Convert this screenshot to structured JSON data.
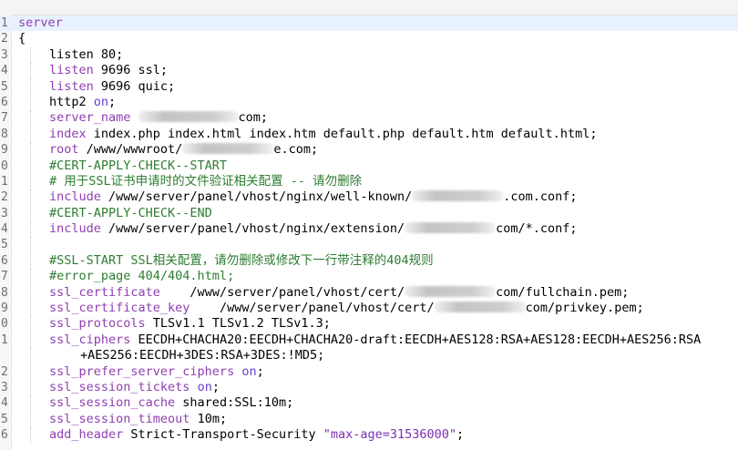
{
  "editor": {
    "lines": [
      {
        "num": "1",
        "current": true,
        "indent": 0,
        "segments": [
          {
            "t": "server",
            "c": "kw"
          }
        ]
      },
      {
        "num": "2",
        "indent": 0,
        "segments": [
          {
            "t": "{"
          }
        ]
      },
      {
        "num": "3",
        "indent": 1,
        "segments": [
          {
            "t": "listen 80;"
          }
        ]
      },
      {
        "num": "4",
        "indent": 1,
        "segments": [
          {
            "t": "listen",
            "c": "kw"
          },
          {
            "t": " 9696 ssl;"
          }
        ]
      },
      {
        "num": "5",
        "indent": 1,
        "segments": [
          {
            "t": "listen",
            "c": "kw"
          },
          {
            "t": " 9696 quic;"
          }
        ]
      },
      {
        "num": "6",
        "indent": 1,
        "segments": [
          {
            "t": "http2 "
          },
          {
            "t": "on",
            "c": "bool"
          },
          {
            "t": ";"
          }
        ]
      },
      {
        "num": "7",
        "indent": 1,
        "segments": [
          {
            "t": "server_name",
            "c": "kw"
          },
          {
            "t": " "
          },
          {
            "blur": 110
          },
          {
            "t": "com;"
          }
        ]
      },
      {
        "num": "8",
        "indent": 1,
        "segments": [
          {
            "t": "index",
            "c": "kw"
          },
          {
            "t": " index.php index.html index.htm default.php default.htm default.html;"
          }
        ]
      },
      {
        "num": "9",
        "indent": 1,
        "segments": [
          {
            "t": "root",
            "c": "kw"
          },
          {
            "t": " /www/wwwroot/"
          },
          {
            "blur": 100
          },
          {
            "t": "e.com;"
          }
        ]
      },
      {
        "num": "0",
        "indent": 1,
        "segments": [
          {
            "t": "#CERT-APPLY-CHECK--START",
            "c": "cmt"
          }
        ]
      },
      {
        "num": "1",
        "indent": 1,
        "segments": [
          {
            "t": "# 用于SSL证书申请时的文件验证相关配置 -- 请勿删除",
            "c": "cmt"
          }
        ]
      },
      {
        "num": "2",
        "indent": 1,
        "segments": [
          {
            "t": "include",
            "c": "kw"
          },
          {
            "t": " /www/server/panel/vhost/nginx/well-known/"
          },
          {
            "blur": 100
          },
          {
            "t": ".com.conf;"
          }
        ]
      },
      {
        "num": "3",
        "indent": 1,
        "segments": [
          {
            "t": "#CERT-APPLY-CHECK--END",
            "c": "cmt"
          }
        ]
      },
      {
        "num": "4",
        "indent": 1,
        "segments": [
          {
            "t": "include",
            "c": "kw"
          },
          {
            "t": " /www/server/panel/vhost/nginx/extension/"
          },
          {
            "blur": 100
          },
          {
            "t": "com/*.conf;"
          }
        ]
      },
      {
        "num": "5",
        "indent": 1,
        "segments": [
          {
            "t": ""
          }
        ]
      },
      {
        "num": "6",
        "indent": 1,
        "segments": [
          {
            "t": "#SSL-START SSL相关配置，请勿删除或修改下一行带注释的404规则",
            "c": "cmt"
          }
        ]
      },
      {
        "num": "7",
        "indent": 1,
        "segments": [
          {
            "t": "#error_page 404/404.html;",
            "c": "cmt"
          }
        ]
      },
      {
        "num": "8",
        "indent": 1,
        "segments": [
          {
            "t": "ssl_certificate",
            "c": "kw"
          },
          {
            "t": "    /www/server/panel/vhost/cert/"
          },
          {
            "blur": 100
          },
          {
            "t": "com/fullchain.pem;"
          }
        ]
      },
      {
        "num": "9",
        "indent": 1,
        "segments": [
          {
            "t": "ssl_certificate_key",
            "c": "kw"
          },
          {
            "t": "    /www/server/panel/vhost/cert/"
          },
          {
            "blur": 100
          },
          {
            "t": "com/privkey.pem;"
          }
        ]
      },
      {
        "num": "0",
        "indent": 1,
        "segments": [
          {
            "t": "ssl_protocols",
            "c": "kw"
          },
          {
            "t": " TLSv1.1 TLSv1.2 TLSv1.3;"
          }
        ]
      },
      {
        "num": "1",
        "indent": 1,
        "segments": [
          {
            "t": "ssl_ciphers",
            "c": "kw"
          },
          {
            "t": " EECDH+CHACHA20:EECDH+CHACHA20-draft:EECDH+AES128:RSA+AES128:EECDH+AES256:RSA"
          }
        ]
      },
      {
        "num": "",
        "indent": 2,
        "segments": [
          {
            "t": "+AES256:EECDH+3DES:RSA+3DES:!MD5;"
          }
        ]
      },
      {
        "num": "2",
        "indent": 1,
        "segments": [
          {
            "t": "ssl_prefer_server_ciphers",
            "c": "kw"
          },
          {
            "t": " "
          },
          {
            "t": "on",
            "c": "bool"
          },
          {
            "t": ";"
          }
        ]
      },
      {
        "num": "3",
        "indent": 1,
        "segments": [
          {
            "t": "ssl_session_tickets",
            "c": "kw"
          },
          {
            "t": " "
          },
          {
            "t": "on",
            "c": "bool"
          },
          {
            "t": ";"
          }
        ]
      },
      {
        "num": "4",
        "indent": 1,
        "segments": [
          {
            "t": "ssl_session_cache",
            "c": "kw"
          },
          {
            "t": " shared:SSL:10m;"
          }
        ]
      },
      {
        "num": "5",
        "indent": 1,
        "segments": [
          {
            "t": "ssl_session_timeout",
            "c": "kw"
          },
          {
            "t": " 10m;"
          }
        ]
      },
      {
        "num": "6",
        "indent": 1,
        "segments": [
          {
            "t": "add_header",
            "c": "kw"
          },
          {
            "t": " Strict-Transport-Security "
          },
          {
            "t": "\"max-age=31536000\"",
            "c": "str"
          },
          {
            "t": ";"
          }
        ]
      }
    ]
  },
  "colors": {
    "keyword": "#8f3fb0",
    "comment": "#2e7d32",
    "boolean": "#6a3fd0",
    "string": "#7a2fb5",
    "current_line": "#e8f2fe"
  }
}
